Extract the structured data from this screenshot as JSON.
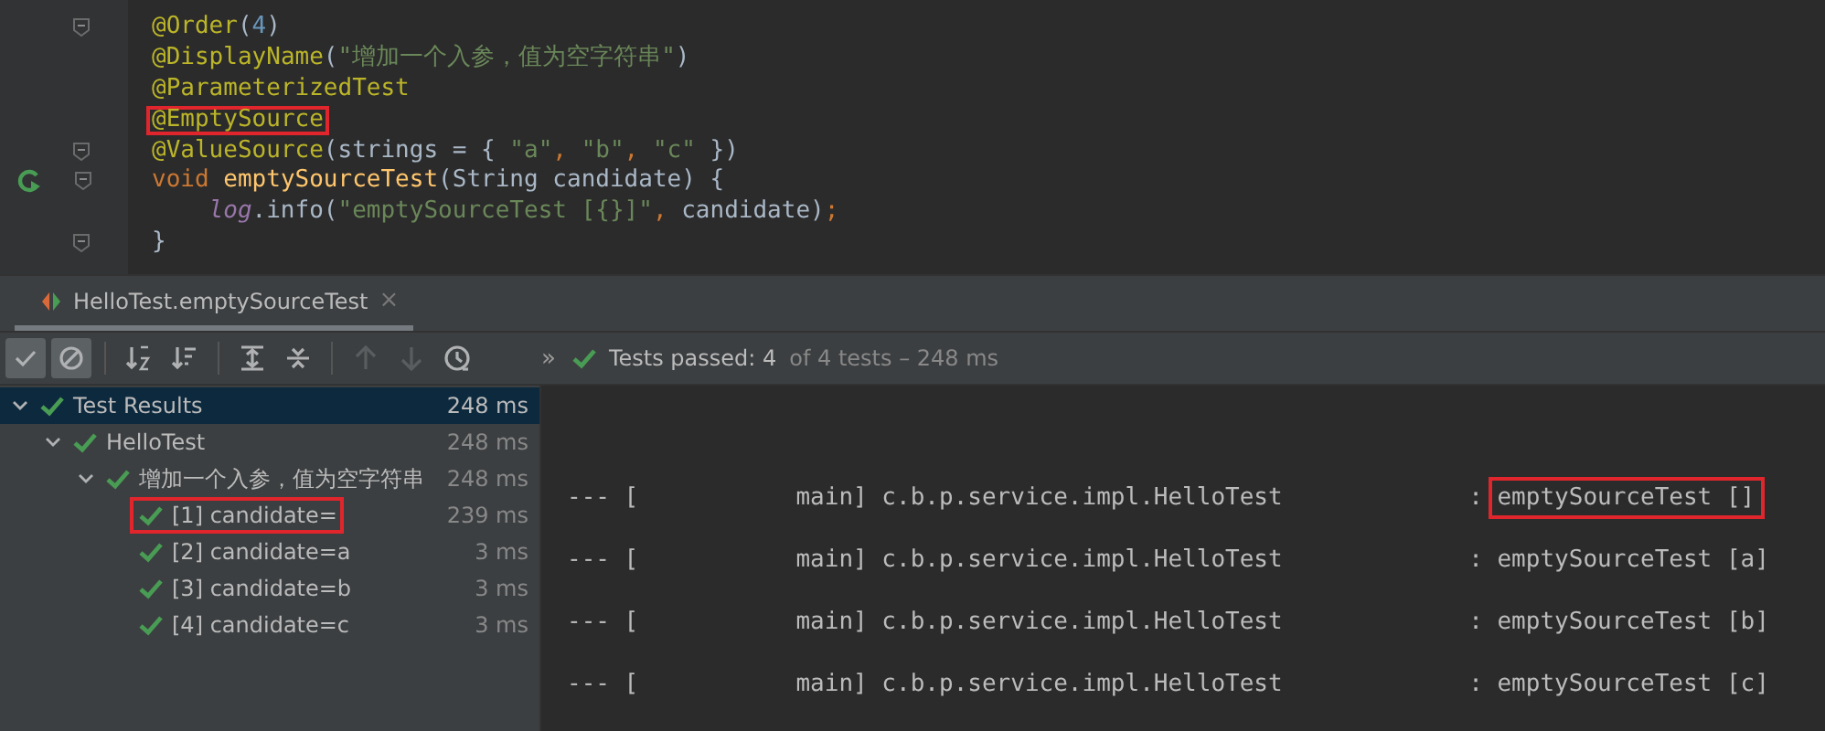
{
  "editor": {
    "lines": [
      {
        "fold": true,
        "run": false,
        "indented": false,
        "tokens": [
          {
            "kind": "annotation",
            "text": "@Order",
            "highlighted": false
          },
          {
            "kind": "plain",
            "text": "(",
            "highlighted": false
          },
          {
            "kind": "number",
            "text": "4",
            "highlighted": false
          },
          {
            "kind": "plain",
            "text": ")",
            "highlighted": false
          }
        ]
      },
      {
        "fold": false,
        "run": false,
        "indented": false,
        "tokens": [
          {
            "kind": "annotation",
            "text": "@DisplayName",
            "highlighted": false
          },
          {
            "kind": "plain",
            "text": "(",
            "highlighted": false
          },
          {
            "kind": "string",
            "text": "\"增加一个入参，值为空字符串\"",
            "highlighted": false
          },
          {
            "kind": "plain",
            "text": ")",
            "highlighted": false
          }
        ]
      },
      {
        "fold": false,
        "run": false,
        "indented": false,
        "tokens": [
          {
            "kind": "annotation",
            "text": "@ParameterizedTest",
            "highlighted": false
          }
        ]
      },
      {
        "fold": false,
        "run": false,
        "indented": false,
        "tokens": [
          {
            "kind": "annotation",
            "text": "@EmptySource",
            "highlighted": true
          }
        ]
      },
      {
        "fold": true,
        "run": false,
        "indented": false,
        "tokens": [
          {
            "kind": "annotation",
            "text": "@ValueSource",
            "highlighted": false
          },
          {
            "kind": "plain",
            "text": "(strings = { ",
            "highlighted": false
          },
          {
            "kind": "string",
            "text": "\"a\"",
            "highlighted": false
          },
          {
            "kind": "keyword",
            "text": ", ",
            "highlighted": false
          },
          {
            "kind": "string",
            "text": "\"b\"",
            "highlighted": false
          },
          {
            "kind": "keyword",
            "text": ", ",
            "highlighted": false
          },
          {
            "kind": "string",
            "text": "\"c\"",
            "highlighted": false
          },
          {
            "kind": "plain",
            "text": " })",
            "highlighted": false
          }
        ]
      },
      {
        "fold": true,
        "run": true,
        "indented": false,
        "tokens": [
          {
            "kind": "keyword",
            "text": "void ",
            "highlighted": false
          },
          {
            "kind": "method",
            "text": "emptySourceTest",
            "highlighted": false
          },
          {
            "kind": "plain",
            "text": "(String candidate) {",
            "highlighted": false
          }
        ]
      },
      {
        "fold": false,
        "run": false,
        "indented": true,
        "tokens": [
          {
            "kind": "field",
            "text": "log",
            "highlighted": false
          },
          {
            "kind": "plain",
            "text": ".info(",
            "highlighted": false
          },
          {
            "kind": "string",
            "text": "\"emptySourceTest [{}]\"",
            "highlighted": false
          },
          {
            "kind": "keyword",
            "text": ", ",
            "highlighted": false
          },
          {
            "kind": "plain",
            "text": "candidate)",
            "highlighted": false
          },
          {
            "kind": "keyword",
            "text": ";",
            "highlighted": false
          }
        ]
      },
      {
        "fold": true,
        "run": false,
        "indented": false,
        "tokens": [
          {
            "kind": "plain",
            "text": "}",
            "highlighted": false
          }
        ]
      }
    ]
  },
  "run_tab": {
    "title": "HelloTest.emptySourceTest",
    "close": "×",
    "selected": true
  },
  "toolbar": {
    "buttons": [
      {
        "kind": "show-passed",
        "selected": true,
        "disabled": false
      },
      {
        "kind": "show-ignored",
        "selected": true,
        "disabled": false
      },
      {
        "kind": "sort-alpha",
        "selected": false,
        "disabled": false
      },
      {
        "kind": "sort-duration",
        "selected": false,
        "disabled": false
      },
      {
        "kind": "expand-all",
        "selected": false,
        "disabled": false
      },
      {
        "kind": "collapse-all",
        "selected": false,
        "disabled": false
      },
      {
        "kind": "previous",
        "selected": false,
        "disabled": true
      },
      {
        "kind": "next",
        "selected": false,
        "disabled": true
      },
      {
        "kind": "history",
        "selected": false,
        "disabled": false
      }
    ],
    "more": "»",
    "status": "Tests passed: 4",
    "status_detail": "of 4 tests – 248 ms"
  },
  "tree": [
    {
      "label": "Test Results",
      "time": "248 ms",
      "selected": true,
      "expanded": true,
      "highlighted": false,
      "children": [
        {
          "label": "HelloTest",
          "time": "248 ms",
          "selected": false,
          "expanded": true,
          "highlighted": false,
          "children": [
            {
              "label": "增加一个入参，值为空字符串",
              "time": "248 ms",
              "selected": false,
              "expanded": true,
              "highlighted": false,
              "children": [
                {
                  "label": "[1] candidate=",
                  "time": "239 ms",
                  "selected": false,
                  "highlighted": true
                },
                {
                  "label": "[2] candidate=a",
                  "time": "3 ms",
                  "selected": false,
                  "highlighted": false
                },
                {
                  "label": "[3] candidate=b",
                  "time": "3 ms",
                  "selected": false,
                  "highlighted": false
                },
                {
                  "label": "[4] candidate=c",
                  "time": "3 ms",
                  "selected": false,
                  "highlighted": false
                }
              ]
            }
          ]
        }
      ]
    }
  ],
  "console": [
    {
      "prefix": "--- [           main] c.b.p.service.impl.HelloTest             : ",
      "message": "emptySourceTest []",
      "highlighted": true
    },
    {
      "prefix": "--- [           main] c.b.p.service.impl.HelloTest             : ",
      "message": "emptySourceTest [a]",
      "highlighted": false
    },
    {
      "prefix": "--- [           main] c.b.p.service.impl.HelloTest             : ",
      "message": "emptySourceTest [b]",
      "highlighted": false
    },
    {
      "prefix": "--- [           main] c.b.p.service.impl.HelloTest             : ",
      "message": "emptySourceTest [c]",
      "highlighted": false
    }
  ]
}
